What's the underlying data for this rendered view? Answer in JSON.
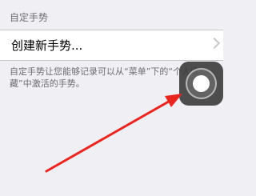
{
  "section": {
    "header": "自定手势"
  },
  "cell": {
    "label": "创建新手势..."
  },
  "footer": {
    "text": "自定手势让您能够记录可以从“菜单”下的“个人收藏”中激活的手势。"
  },
  "assistive_touch": {
    "icon": "assistive-touch-icon"
  },
  "annotation": {
    "arrow_color": "#e8261f"
  },
  "colors": {
    "background": "#efeff4",
    "cell": "#ffffff",
    "secondary_text": "#6d6d72"
  }
}
